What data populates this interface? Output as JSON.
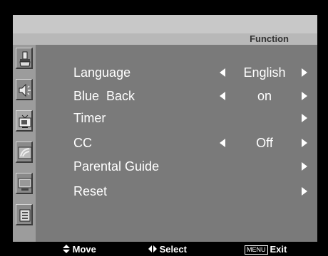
{
  "header": {
    "title": "Function"
  },
  "sidebar": {
    "items": [
      {
        "icon": "paint-brush-icon"
      },
      {
        "icon": "speaker-icon"
      },
      {
        "icon": "tv-icon"
      },
      {
        "icon": "satellite-dish-icon"
      },
      {
        "icon": "monitor-icon"
      },
      {
        "icon": "function-panel-icon"
      }
    ]
  },
  "menu": {
    "items": [
      {
        "label": "Language",
        "value": "English"
      },
      {
        "label": "Blue  Back",
        "value": "on"
      },
      {
        "label": "Timer",
        "value": ""
      },
      {
        "label": "CC",
        "value": "Off"
      },
      {
        "label": "Parental Guide",
        "value": ""
      },
      {
        "label": "Reset",
        "value": ""
      }
    ]
  },
  "footer": {
    "move_label": "Move",
    "select_label": "Select",
    "menu_key": "MENU",
    "exit_label": "Exit"
  }
}
